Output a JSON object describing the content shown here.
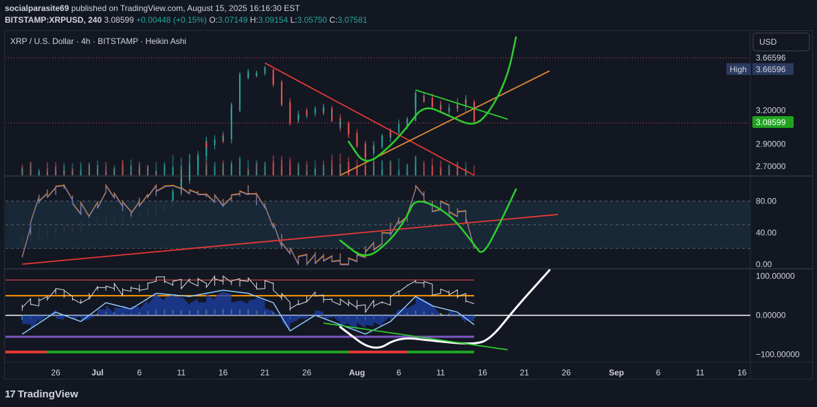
{
  "header": {
    "publisher": "socialparasite69",
    "published_text": "published on TradingView.com, August 15, 2025 16:16:30 EST",
    "symbol": "BITSTAMP:XRPUSD, 240",
    "last": "3.08599",
    "change": "+0.00448 (+0.15%)",
    "ohlc_o_label": "O:",
    "ohlc_o": "3.07149",
    "ohlc_h_label": "H:",
    "ohlc_h": "3.09154",
    "ohlc_l_label": "L:",
    "ohlc_l": "3.05750",
    "ohlc_c_label": "C:",
    "ohlc_c": "3.07581"
  },
  "chart_title": "XRP / U.S. Dollar · 4h · BITSTAMP · Heikin Ashi",
  "currency_button": "USD",
  "high_label": "High",
  "high_value": "3.66596",
  "price_label": "3.08599",
  "footer_brand": "TradingView",
  "colors": {
    "background": "#131722",
    "up": "#26a69a",
    "down": "#ef5350",
    "price_green": "#1fa31f",
    "price_red": "#d32f2f",
    "drawing_green": "#2ecc2e",
    "drawing_red": "#e53935",
    "drawing_orange": "#e08a3c",
    "rsi_band": "#1a2a38",
    "high_tag": "#2b3a5e"
  },
  "chart_data": [
    {
      "type": "candlestick",
      "name": "XRP / U.S. Dollar",
      "subtype": "heikin-ashi",
      "timeframe": "4h",
      "yticks": [
        "2.70000",
        "2.90000",
        "3.20000",
        "3.66596"
      ],
      "last_price": 3.08599,
      "high": 3.66596,
      "xticks": [
        "26",
        "Jul",
        "6",
        "11",
        "16",
        "21",
        "26",
        "Aug",
        "6",
        "11",
        "16",
        "21",
        "26",
        "Sep",
        "6",
        "11",
        "16"
      ],
      "segments": [
        [
          "2025-06-22",
          2.05
        ],
        [
          "2025-06-26",
          2.12
        ],
        [
          "2025-07-01",
          2.2
        ],
        [
          "2025-07-05",
          2.25
        ],
        [
          "2025-07-09",
          2.35
        ],
        [
          "2025-07-11",
          2.6
        ],
        [
          "2025-07-14",
          2.9
        ],
        [
          "2025-07-16",
          2.95
        ],
        [
          "2025-07-18",
          3.5
        ],
        [
          "2025-07-21",
          3.55
        ],
        [
          "2025-07-22",
          3.45
        ],
        [
          "2025-07-24",
          3.1
        ],
        [
          "2025-07-26",
          3.18
        ],
        [
          "2025-07-28",
          3.2
        ],
        [
          "2025-07-31",
          3.0
        ],
        [
          "2025-08-02",
          2.8
        ],
        [
          "2025-08-04",
          2.95
        ],
        [
          "2025-08-07",
          3.1
        ],
        [
          "2025-08-08",
          3.35
        ],
        [
          "2025-08-10",
          3.25
        ],
        [
          "2025-08-12",
          3.2
        ],
        [
          "2025-08-14",
          3.28
        ],
        [
          "2025-08-15",
          3.07
        ]
      ],
      "drawings": [
        {
          "kind": "downtrend-line",
          "color": "red",
          "from": [
            "2025-07-21",
            3.62
          ],
          "to": [
            "2025-08-15",
            2.62
          ]
        },
        {
          "kind": "uptrend-line",
          "color": "orange",
          "from": [
            "2025-07-30",
            2.62
          ],
          "to": [
            "2025-08-24",
            3.55
          ]
        },
        {
          "kind": "channel-top",
          "color": "green",
          "from": [
            "2025-08-08",
            3.38
          ],
          "to": [
            "2025-08-19",
            3.12
          ]
        },
        {
          "kind": "projection-path",
          "color": "green",
          "points": [
            [
              "2025-07-31",
              2.92
            ],
            [
              "2025-08-02",
              2.7
            ],
            [
              "2025-08-05",
              2.88
            ],
            [
              "2025-08-07",
              3.05
            ],
            [
              "2025-08-09",
              3.25
            ],
            [
              "2025-08-12",
              3.15
            ],
            [
              "2025-08-15",
              3.05
            ],
            [
              "2025-08-17",
              3.2
            ],
            [
              "2025-08-19",
              3.5
            ],
            [
              "2025-08-20",
              3.85
            ]
          ]
        }
      ]
    },
    {
      "type": "line",
      "name": "RSI",
      "yticks": [
        "0.00",
        "40.00",
        "80.00"
      ],
      "ylim": [
        -5,
        110
      ],
      "band": [
        20,
        80
      ],
      "values": [
        [
          "2025-06-22",
          5
        ],
        [
          "2025-06-24",
          85
        ],
        [
          "2025-06-27",
          95
        ],
        [
          "2025-06-30",
          60
        ],
        [
          "2025-07-02",
          95
        ],
        [
          "2025-07-05",
          65
        ],
        [
          "2025-07-07",
          90
        ],
        [
          "2025-07-10",
          100
        ],
        [
          "2025-07-13",
          90
        ],
        [
          "2025-07-16",
          80
        ],
        [
          "2025-07-19",
          95
        ],
        [
          "2025-07-21",
          70
        ],
        [
          "2025-07-23",
          30
        ],
        [
          "2025-07-25",
          5
        ],
        [
          "2025-07-28",
          10
        ],
        [
          "2025-07-31",
          5
        ],
        [
          "2025-08-03",
          20
        ],
        [
          "2025-08-05",
          45
        ],
        [
          "2025-08-07",
          60
        ],
        [
          "2025-08-08",
          100
        ],
        [
          "2025-08-10",
          75
        ],
        [
          "2025-08-12",
          70
        ],
        [
          "2025-08-14",
          60
        ],
        [
          "2025-08-15",
          15
        ]
      ],
      "drawings": [
        {
          "kind": "trend-line",
          "color": "red",
          "from": [
            "2025-06-22",
            0
          ],
          "to": [
            "2025-08-25",
            63
          ]
        },
        {
          "kind": "projection-path",
          "color": "green",
          "points": [
            [
              "2025-07-30",
              30
            ],
            [
              "2025-08-02",
              5
            ],
            [
              "2025-08-05",
              30
            ],
            [
              "2025-08-07",
              60
            ],
            [
              "2025-08-08",
              85
            ],
            [
              "2025-08-12",
              65
            ],
            [
              "2025-08-15",
              25
            ],
            [
              "2025-08-16",
              10
            ],
            [
              "2025-08-18",
              50
            ],
            [
              "2025-08-20",
              95
            ]
          ]
        }
      ]
    },
    {
      "type": "line",
      "name": "Oscillator",
      "yticks": [
        "100.00000",
        "0.00000",
        "−100.00000"
      ],
      "ylim": [
        -120,
        115
      ],
      "values": [
        [
          "2025-06-22",
          -60
        ],
        [
          "2025-06-26",
          10
        ],
        [
          "2025-06-29",
          -20
        ],
        [
          "2025-07-02",
          40
        ],
        [
          "2025-07-05",
          20
        ],
        [
          "2025-07-08",
          70
        ],
        [
          "2025-07-12",
          60
        ],
        [
          "2025-07-16",
          80
        ],
        [
          "2025-07-19",
          70
        ],
        [
          "2025-07-22",
          40
        ],
        [
          "2025-07-24",
          -50
        ],
        [
          "2025-07-27",
          0
        ],
        [
          "2025-07-30",
          -30
        ],
        [
          "2025-08-02",
          -60
        ],
        [
          "2025-08-05",
          -20
        ],
        [
          "2025-08-08",
          60
        ],
        [
          "2025-08-10",
          30
        ],
        [
          "2025-08-13",
          10
        ],
        [
          "2025-08-15",
          -30
        ]
      ],
      "drawings": [
        {
          "kind": "projection-path",
          "color": "white",
          "points": [
            [
              "2025-07-30",
              -30
            ],
            [
              "2025-08-03",
              -95
            ],
            [
              "2025-08-06",
              -55
            ],
            [
              "2025-08-10",
              -65
            ],
            [
              "2025-08-15",
              -75
            ],
            [
              "2025-08-17",
              -60
            ],
            [
              "2025-08-20",
              20
            ],
            [
              "2025-08-24",
              115
            ]
          ]
        },
        {
          "kind": "trend-line",
          "color": "green",
          "from": [
            "2025-07-28",
            -20
          ],
          "to": [
            "2025-08-19",
            -88
          ]
        }
      ]
    }
  ]
}
